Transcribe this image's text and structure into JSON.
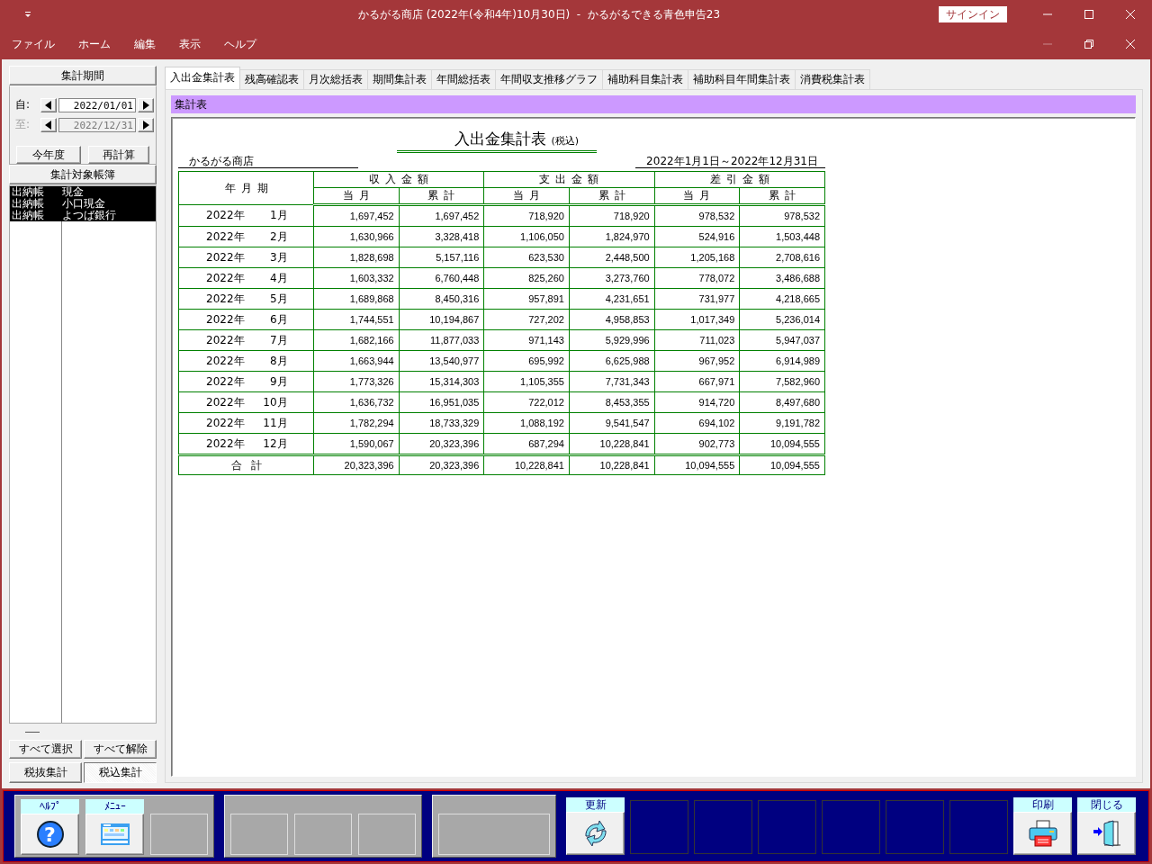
{
  "window": {
    "title": "かるがる商店 (2022年(令和4年)10月30日)  -  かるがるできる青色申告23",
    "sign_in": "サインイン"
  },
  "menu": [
    "ファイル",
    "ホーム",
    "編集",
    "表示",
    "ヘルプ"
  ],
  "sidebar": {
    "period_header": "集計期間",
    "from": {
      "label": "自:",
      "value": "2022/01/01",
      "disabled": false
    },
    "to": {
      "label": "至:",
      "value": "2022/12/31",
      "disabled": true
    },
    "period_buttons": [
      "今年度",
      "再計算"
    ],
    "ledger_header": "集計対象帳簿",
    "ledgers": [
      {
        "type": "出納帳",
        "name": "現金",
        "selected": true
      },
      {
        "type": "出納帳",
        "name": "小口現金",
        "selected": true
      },
      {
        "type": "出納帳",
        "name": "よつば銀行",
        "selected": true
      }
    ],
    "select_buttons": [
      "すべて選択",
      "すべて解除"
    ],
    "tax_modes": [
      {
        "label": "税抜集計",
        "selected": false
      },
      {
        "label": "税込集計",
        "selected": true
      }
    ]
  },
  "tabs": [
    {
      "label": "入出金集計表",
      "selected": true
    },
    {
      "label": "残高確認表",
      "selected": false
    },
    {
      "label": "月次総括表",
      "selected": false
    },
    {
      "label": "期間集計表",
      "selected": false
    },
    {
      "label": "年間総括表",
      "selected": false
    },
    {
      "label": "年間収支推移グラフ",
      "selected": false
    },
    {
      "label": "補助科目集計表",
      "selected": false
    },
    {
      "label": "補助科目年間集計表",
      "selected": false
    },
    {
      "label": "消費税集計表",
      "selected": false
    }
  ],
  "section_bar": "集計表",
  "report": {
    "title": "入出金集計表",
    "title_note": "(税込)",
    "company": "かるがる商店",
    "period": "2022年1月1日～2022年12月31日",
    "month_header": "年月期",
    "groups": [
      "収入金額",
      "支出金額",
      "差引金額"
    ],
    "sub_headers": [
      "当月",
      "累計",
      "当月",
      "累計",
      "当月",
      "累計"
    ],
    "rows": [
      {
        "year": "2022年",
        "month": "1月",
        "values": [
          "1,697,452",
          "1,697,452",
          "718,920",
          "718,920",
          "978,532",
          "978,532"
        ]
      },
      {
        "year": "2022年",
        "month": "2月",
        "values": [
          "1,630,966",
          "3,328,418",
          "1,106,050",
          "1,824,970",
          "524,916",
          "1,503,448"
        ]
      },
      {
        "year": "2022年",
        "month": "3月",
        "values": [
          "1,828,698",
          "5,157,116",
          "623,530",
          "2,448,500",
          "1,205,168",
          "2,708,616"
        ]
      },
      {
        "year": "2022年",
        "month": "4月",
        "values": [
          "1,603,332",
          "6,760,448",
          "825,260",
          "3,273,760",
          "778,072",
          "3,486,688"
        ]
      },
      {
        "year": "2022年",
        "month": "5月",
        "values": [
          "1,689,868",
          "8,450,316",
          "957,891",
          "4,231,651",
          "731,977",
          "4,218,665"
        ]
      },
      {
        "year": "2022年",
        "month": "6月",
        "values": [
          "1,744,551",
          "10,194,867",
          "727,202",
          "4,958,853",
          "1,017,349",
          "5,236,014"
        ]
      },
      {
        "year": "2022年",
        "month": "7月",
        "values": [
          "1,682,166",
          "11,877,033",
          "971,143",
          "5,929,996",
          "711,023",
          "5,947,037"
        ]
      },
      {
        "year": "2022年",
        "month": "8月",
        "values": [
          "1,663,944",
          "13,540,977",
          "695,992",
          "6,625,988",
          "967,952",
          "6,914,989"
        ]
      },
      {
        "year": "2022年",
        "month": "9月",
        "values": [
          "1,773,326",
          "15,314,303",
          "1,105,355",
          "7,731,343",
          "667,971",
          "7,582,960"
        ]
      },
      {
        "year": "2022年",
        "month": "10月",
        "values": [
          "1,636,732",
          "16,951,035",
          "722,012",
          "8,453,355",
          "914,720",
          "8,497,680"
        ]
      },
      {
        "year": "2022年",
        "month": "11月",
        "values": [
          "1,782,294",
          "18,733,329",
          "1,088,192",
          "9,541,547",
          "694,102",
          "9,191,782"
        ]
      },
      {
        "year": "2022年",
        "month": "12月",
        "values": [
          "1,590,067",
          "20,323,396",
          "687,294",
          "10,228,841",
          "902,773",
          "10,094,555"
        ]
      }
    ],
    "total": {
      "label": "合計",
      "values": [
        "20,323,396",
        "20,323,396",
        "10,228,841",
        "10,228,841",
        "10,094,555",
        "10,094,555"
      ]
    }
  },
  "toolbar": {
    "groups": [
      {
        "keys": [
          {
            "kind": "help",
            "label": "ﾍﾙﾌﾟ",
            "glyph": "?"
          },
          {
            "kind": "menu",
            "label": "ﾒﾆｭｰ"
          },
          {
            "kind": "empty"
          }
        ]
      },
      {
        "keys": [
          {
            "kind": "empty"
          },
          {
            "kind": "empty"
          },
          {
            "kind": "empty"
          }
        ]
      },
      {
        "keys": [
          {
            "kind": "wide_empty"
          }
        ]
      }
    ],
    "keys": [
      {
        "kind": "refresh",
        "label": "更新"
      },
      {
        "kind": "blank"
      },
      {
        "kind": "blank"
      },
      {
        "kind": "blank"
      },
      {
        "kind": "blank"
      },
      {
        "kind": "blank"
      },
      {
        "kind": "blank"
      },
      {
        "kind": "print",
        "label": "印刷"
      },
      {
        "kind": "close",
        "label": "閉じる"
      }
    ]
  }
}
